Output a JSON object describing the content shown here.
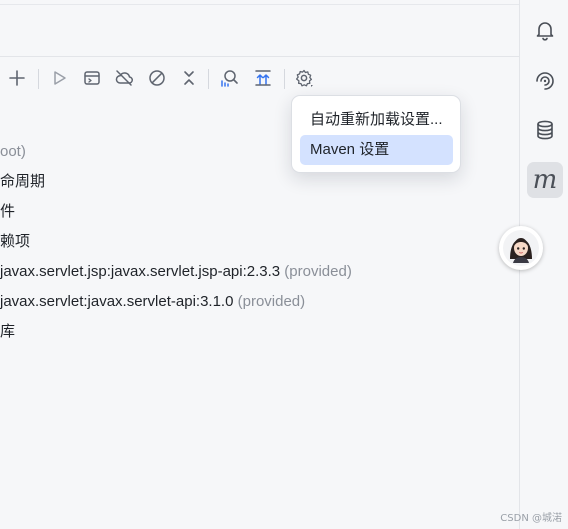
{
  "toolbar": {
    "buttons": [
      {
        "name": "add-icon"
      },
      {
        "name": "run-icon"
      },
      {
        "name": "run-config-icon"
      },
      {
        "name": "offline-mode-icon"
      },
      {
        "name": "skip-tests-icon"
      },
      {
        "name": "collapse-icon"
      },
      {
        "name": "dependency-analyzer-icon"
      },
      {
        "name": "show-updates-icon"
      },
      {
        "name": "settings-icon"
      }
    ]
  },
  "tree": {
    "rows": [
      {
        "text": "oot)",
        "suffix": ""
      },
      {
        "text": "命周期",
        "suffix": ""
      },
      {
        "text": "件",
        "suffix": ""
      },
      {
        "text": "赖项",
        "suffix": ""
      },
      {
        "text": "javax.servlet.jsp:javax.servlet.jsp-api:2.3.3",
        "suffix": "(provided)"
      },
      {
        "text": "javax.servlet:javax.servlet-api:3.1.0",
        "suffix": "(provided)"
      },
      {
        "text": "库",
        "suffix": ""
      }
    ]
  },
  "menu": {
    "items": [
      {
        "label": "自动重新加载设置...",
        "selected": false
      },
      {
        "label": "Maven 设置",
        "selected": true
      }
    ]
  },
  "right_strip": {
    "buttons": [
      {
        "name": "notifications-icon"
      },
      {
        "name": "ai-assistant-icon"
      },
      {
        "name": "database-icon"
      },
      {
        "name": "maven-icon",
        "glyph": "m",
        "active": true
      }
    ]
  },
  "watermark": "CSDN @城渃",
  "colors": {
    "background": "#f6f7f9",
    "menu_selected": "#d4e2ff",
    "muted_text": "#8a8f98"
  }
}
